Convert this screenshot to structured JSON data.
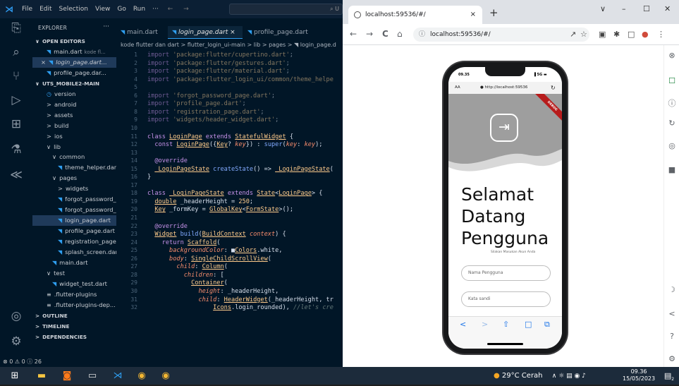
{
  "vscode": {
    "menu": [
      "File",
      "Edit",
      "Selection",
      "View",
      "Go",
      "Run",
      "···"
    ],
    "command_center": "⌕ U",
    "explorer_title": "EXPLORER",
    "explorer_more": "···",
    "tree": [
      {
        "label": "OPEN EDITORS",
        "indent": 0,
        "kind": "section",
        "chev": "∨"
      },
      {
        "label": "main.dart",
        "extra": "kode fl...",
        "indent": 2,
        "kind": "dart"
      },
      {
        "label": "login_page.dart...",
        "indent": 1,
        "kind": "dart",
        "selected": true,
        "italic": true,
        "close": "×"
      },
      {
        "label": "profile_page.dar...",
        "indent": 2,
        "kind": "dart"
      },
      {
        "label": "UTS_MOBILE2-MAIN",
        "indent": 0,
        "kind": "section",
        "chev": "∨"
      },
      {
        "label": "version",
        "indent": 2,
        "kind": "clock"
      },
      {
        "label": "android",
        "indent": 2,
        "kind": "folder",
        "chev": ">"
      },
      {
        "label": "assets",
        "indent": 2,
        "kind": "folder",
        "chev": ">"
      },
      {
        "label": "build",
        "indent": 2,
        "kind": "folder",
        "chev": ">"
      },
      {
        "label": "ios",
        "indent": 2,
        "kind": "folder",
        "chev": ">"
      },
      {
        "label": "lib",
        "indent": 2,
        "kind": "folder",
        "chev": "∨"
      },
      {
        "label": "common",
        "indent": 3,
        "kind": "folder",
        "chev": "∨"
      },
      {
        "label": "theme_helper.dart",
        "indent": 4,
        "kind": "dart"
      },
      {
        "label": "pages",
        "indent": 3,
        "kind": "folder",
        "chev": "∨"
      },
      {
        "label": "widgets",
        "indent": 4,
        "kind": "folder",
        "chev": ">"
      },
      {
        "label": "forgot_password_...",
        "indent": 4,
        "kind": "dart"
      },
      {
        "label": "forgot_password_...",
        "indent": 4,
        "kind": "dart"
      },
      {
        "label": "login_page.dart",
        "indent": 4,
        "kind": "dart",
        "selected": true
      },
      {
        "label": "profile_page.dart",
        "indent": 4,
        "kind": "dart"
      },
      {
        "label": "registration_page...",
        "indent": 4,
        "kind": "dart"
      },
      {
        "label": "splash_screen.dart",
        "indent": 4,
        "kind": "dart"
      },
      {
        "label": "main.dart",
        "indent": 3,
        "kind": "dart"
      },
      {
        "label": "test",
        "indent": 2,
        "kind": "folder",
        "chev": "∨"
      },
      {
        "label": "widget_test.dart",
        "indent": 3,
        "kind": "dart"
      },
      {
        "label": ".flutter-plugins",
        "indent": 2,
        "kind": "text"
      },
      {
        "label": ".flutter-plugins-dep...",
        "indent": 2,
        "kind": "text"
      },
      {
        "label": "OUTLINE",
        "indent": 0,
        "kind": "section",
        "chev": ">"
      },
      {
        "label": "TIMELINE",
        "indent": 0,
        "kind": "section",
        "chev": ">"
      },
      {
        "label": "DEPENDENCIES",
        "indent": 0,
        "kind": "section",
        "chev": ">"
      }
    ],
    "tabs": [
      {
        "label": "main.dart",
        "active": false
      },
      {
        "label": "login_page.dart",
        "active": true,
        "close": "×"
      },
      {
        "label": "profile_page.dart",
        "active": false
      }
    ],
    "breadcrumb": "kode flutter dan dart > flutter_login_ui-main > lib > pages > ◥ login_page.d",
    "code_lines": [
      [
        [
          "k",
          "import "
        ],
        [
          "s",
          "'package:flutter/cupertino.dart'"
        ],
        [
          "v",
          ";"
        ]
      ],
      [
        [
          "k",
          "import "
        ],
        [
          "s",
          "'package:flutter/gestures.dart'"
        ],
        [
          "v",
          ";"
        ]
      ],
      [
        [
          "k",
          "import "
        ],
        [
          "s",
          "'package:flutter/material.dart'"
        ],
        [
          "v",
          ";"
        ]
      ],
      [
        [
          "k",
          "import "
        ],
        [
          "s",
          "'package:flutter_login_ui/common/theme_helpe"
        ]
      ],
      [],
      [
        [
          "k",
          "import "
        ],
        [
          "s",
          "'forgot_password_page.dart'"
        ],
        [
          "v",
          ";"
        ]
      ],
      [
        [
          "k",
          "import "
        ],
        [
          "s",
          "'profile_page.dart'"
        ],
        [
          "v",
          ";"
        ]
      ],
      [
        [
          "k",
          "import "
        ],
        [
          "s",
          "'registration_page.dart'"
        ],
        [
          "v",
          ";"
        ]
      ],
      [
        [
          "k",
          "import "
        ],
        [
          "s",
          "'widgets/header_widget.dart'"
        ],
        [
          "v",
          ";"
        ]
      ],
      [],
      [
        [
          "k",
          "class "
        ],
        [
          "t",
          "LoginPage"
        ],
        [
          "k",
          " extends "
        ],
        [
          "t",
          "StatefulWidget"
        ],
        [
          "v",
          " {"
        ]
      ],
      [
        [
          "v",
          "  "
        ],
        [
          "k",
          "const "
        ],
        [
          "t",
          "LoginPage"
        ],
        [
          "v",
          "({"
        ],
        [
          "t",
          "Key"
        ],
        [
          "v",
          "? "
        ],
        [
          "p",
          "key"
        ],
        [
          "v",
          "}) : "
        ],
        [
          "f",
          "super"
        ],
        [
          "v",
          "("
        ],
        [
          "p",
          "key"
        ],
        [
          "v",
          ": "
        ],
        [
          "p",
          "key"
        ],
        [
          "v",
          ");"
        ]
      ],
      [],
      [
        [
          "v",
          "  "
        ],
        [
          "k",
          "@override"
        ]
      ],
      [
        [
          "v",
          "  "
        ],
        [
          "t",
          "_LoginPageState"
        ],
        [
          "v",
          " "
        ],
        [
          "f",
          "createState"
        ],
        [
          "v",
          "() => "
        ],
        [
          "t",
          "_LoginPageState"
        ],
        [
          "v",
          "("
        ]
      ],
      [
        [
          "v",
          "}"
        ]
      ],
      [],
      [
        [
          "k",
          "class "
        ],
        [
          "t",
          "_LoginPageState"
        ],
        [
          "k",
          " extends "
        ],
        [
          "t",
          "State"
        ],
        [
          "v",
          "<"
        ],
        [
          "t",
          "LoginPage"
        ],
        [
          "v",
          "> {"
        ]
      ],
      [
        [
          "v",
          "  "
        ],
        [
          "t",
          "double"
        ],
        [
          "v",
          " _headerHeight = "
        ],
        [
          "y",
          "250"
        ],
        [
          "v",
          ";"
        ]
      ],
      [
        [
          "v",
          "  "
        ],
        [
          "t",
          "Key"
        ],
        [
          "v",
          " _formKey = "
        ],
        [
          "t",
          "GlobalKey"
        ],
        [
          "v",
          "<"
        ],
        [
          "t",
          "FormState"
        ],
        [
          "v",
          ">();"
        ]
      ],
      [],
      [
        [
          "v",
          "  "
        ],
        [
          "k",
          "@override"
        ]
      ],
      [
        [
          "v",
          "  "
        ],
        [
          "t",
          "Widget"
        ],
        [
          "v",
          " "
        ],
        [
          "f",
          "build"
        ],
        [
          "v",
          "("
        ],
        [
          "t",
          "BuildContext"
        ],
        [
          "v",
          " "
        ],
        [
          "p",
          "context"
        ],
        [
          "v",
          ") {"
        ]
      ],
      [
        [
          "v",
          "    "
        ],
        [
          "k",
          "return "
        ],
        [
          "t",
          "Scaffold"
        ],
        [
          "v",
          "("
        ]
      ],
      [
        [
          "v",
          "      "
        ],
        [
          "p",
          "backgroundColor"
        ],
        [
          "v",
          ": ■"
        ],
        [
          "t",
          "Colors"
        ],
        [
          "v",
          ".white,"
        ]
      ],
      [
        [
          "v",
          "      "
        ],
        [
          "p",
          "body"
        ],
        [
          "v",
          ": "
        ],
        [
          "t",
          "SingleChildScrollView"
        ],
        [
          "v",
          "("
        ]
      ],
      [
        [
          "v",
          "        "
        ],
        [
          "p",
          "child"
        ],
        [
          "v",
          ": "
        ],
        [
          "t",
          "Column"
        ],
        [
          "v",
          "("
        ]
      ],
      [
        [
          "v",
          "          "
        ],
        [
          "p",
          "children"
        ],
        [
          "v",
          ": ["
        ]
      ],
      [
        [
          "v",
          "            "
        ],
        [
          "t",
          "Container"
        ],
        [
          "v",
          "("
        ]
      ],
      [
        [
          "v",
          "              "
        ],
        [
          "p",
          "height"
        ],
        [
          "v",
          ": _headerHeight,"
        ]
      ],
      [
        [
          "v",
          "              "
        ],
        [
          "p",
          "child"
        ],
        [
          "v",
          ": "
        ],
        [
          "t",
          "HeaderWidget"
        ],
        [
          "v",
          "(_headerHeight, tr"
        ]
      ],
      [
        [
          "v",
          "                  "
        ],
        [
          "t",
          "Icons"
        ],
        [
          "v",
          ".login_rounded), "
        ],
        [
          "c",
          "//let's cre"
        ]
      ]
    ],
    "status": "⊗ 0 ⚠ 0 ⓘ 26"
  },
  "chrome": {
    "tab_title": "localhost:59536/#/",
    "tab_close": "×",
    "new_tab": "+",
    "window_controls": [
      "∨",
      "–",
      "☐",
      "✕"
    ],
    "nav": [
      "←",
      "→",
      "C",
      "⌂"
    ],
    "url": "localhost:59536/#/",
    "url_icon": "ⓘ",
    "right_icons": [
      "↗",
      "☆",
      "▣",
      "✱",
      "□",
      "●",
      "⋮"
    ],
    "side_icons": [
      "⊗",
      "☐",
      "ⓘ",
      "↻",
      "◎",
      "■",
      "☽",
      "<",
      "?",
      "⚙"
    ]
  },
  "phone": {
    "time": "09.35",
    "signal": "▐ 5G ▬",
    "safari_aa": "AA",
    "safari_url": "● http://localhost:59536",
    "safari_reload": "↻",
    "ribbon": "DEBUG",
    "login_icon": "⇥",
    "welcome": "Selamat Datang Pengguna",
    "subtitle": "Silakan Masukan Akun Anda",
    "username_placeholder": "Nama Pengguna",
    "password_placeholder": "Kata sandi",
    "footer_icons": [
      "<",
      ">",
      "⇧",
      "□",
      "⧉"
    ]
  },
  "taskbar": {
    "weather": "29°C Cerah",
    "tray_icons": "∧ ☼ ▤ ◉ ♪",
    "time": "09.36",
    "date": "15/05/2023",
    "notif": "2"
  },
  "colors": {
    "vscode_bg": "#011627",
    "accent": "#2f9ef0",
    "taskbar": "#1c2b3b"
  }
}
